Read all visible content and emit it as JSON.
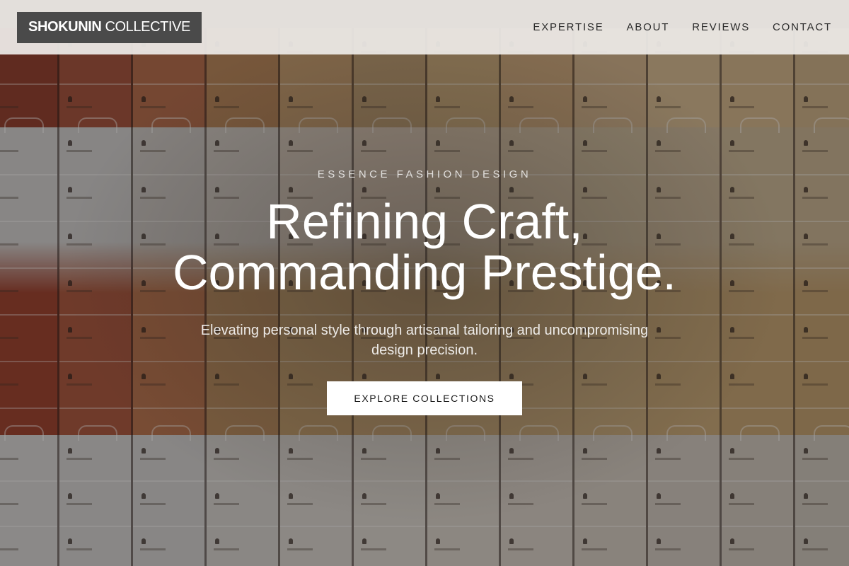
{
  "header": {
    "logo_bold": "SHOKUNIN",
    "logo_light": "COLLECTIVE",
    "nav": [
      {
        "label": "EXPERTISE"
      },
      {
        "label": "ABOUT"
      },
      {
        "label": "REVIEWS"
      },
      {
        "label": "CONTACT"
      }
    ]
  },
  "hero": {
    "eyebrow": "ESSENCE FASHION DESIGN",
    "headline_line1": "Refining Craft,",
    "headline_line2": "Commanding Prestige.",
    "subtext": "Elevating personal style through artisanal tailoring and uncompromising design precision.",
    "cta_label": "EXPLORE COLLECTIONS"
  },
  "background": {
    "description_colors": [
      "#8a3f2e",
      "#a35a3f",
      "#b98d62",
      "#c9a878",
      "#d9d5cf"
    ]
  }
}
